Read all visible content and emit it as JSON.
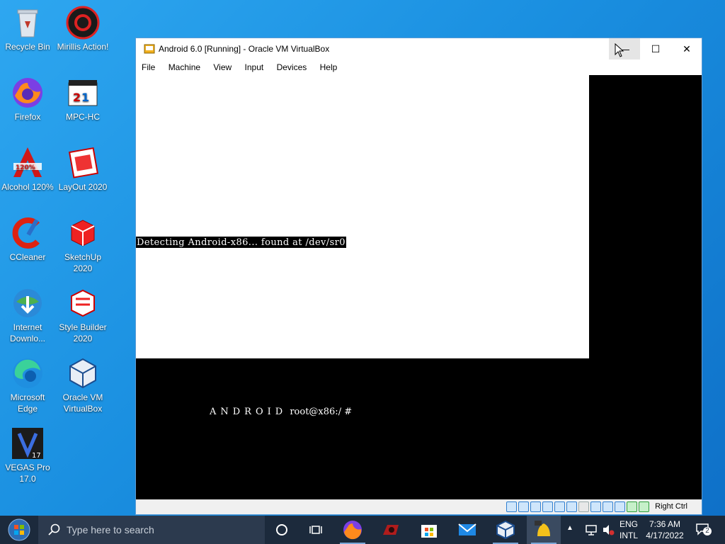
{
  "desktop": {
    "icons": [
      {
        "label": "Recycle Bin"
      },
      {
        "label": "Mirillis Action!"
      },
      {
        "label": "Firefox"
      },
      {
        "label": "MPC-HC"
      },
      {
        "label": "Alcohol 120%"
      },
      {
        "label": "LayOut 2020"
      },
      {
        "label": "CCleaner"
      },
      {
        "label": "SketchUp 2020"
      },
      {
        "label": "Internet Downlo..."
      },
      {
        "label": "Style Builder 2020"
      },
      {
        "label": "Microsoft Edge"
      },
      {
        "label": "Oracle VM VirtualBox"
      },
      {
        "label": "VEGAS Pro 17.0"
      }
    ]
  },
  "window": {
    "title": "Android 6.0 [Running] - Oracle VM VirtualBox",
    "minimize": "—",
    "maximize": "☐",
    "close": "✕",
    "menu": [
      "File",
      "Machine",
      "View",
      "Input",
      "Devices",
      "Help"
    ]
  },
  "guest": {
    "detect_line": "Detecting Android-x86... found at /dev/sr0",
    "android_logo": "ANDROID",
    "prompt": "root@x86:/ #"
  },
  "statusbar": {
    "host_key": "Right Ctrl"
  },
  "taskbar": {
    "search_placeholder": "Type here to search",
    "language": "ENG",
    "layout": "INTL",
    "time": "7:36 AM",
    "date": "4/17/2022",
    "notification_count": "2"
  },
  "colors": {
    "desktop_bg": "#1a8fe0",
    "taskbar_bg": "#1c2a3c",
    "window_border": "#5a9bd5"
  }
}
